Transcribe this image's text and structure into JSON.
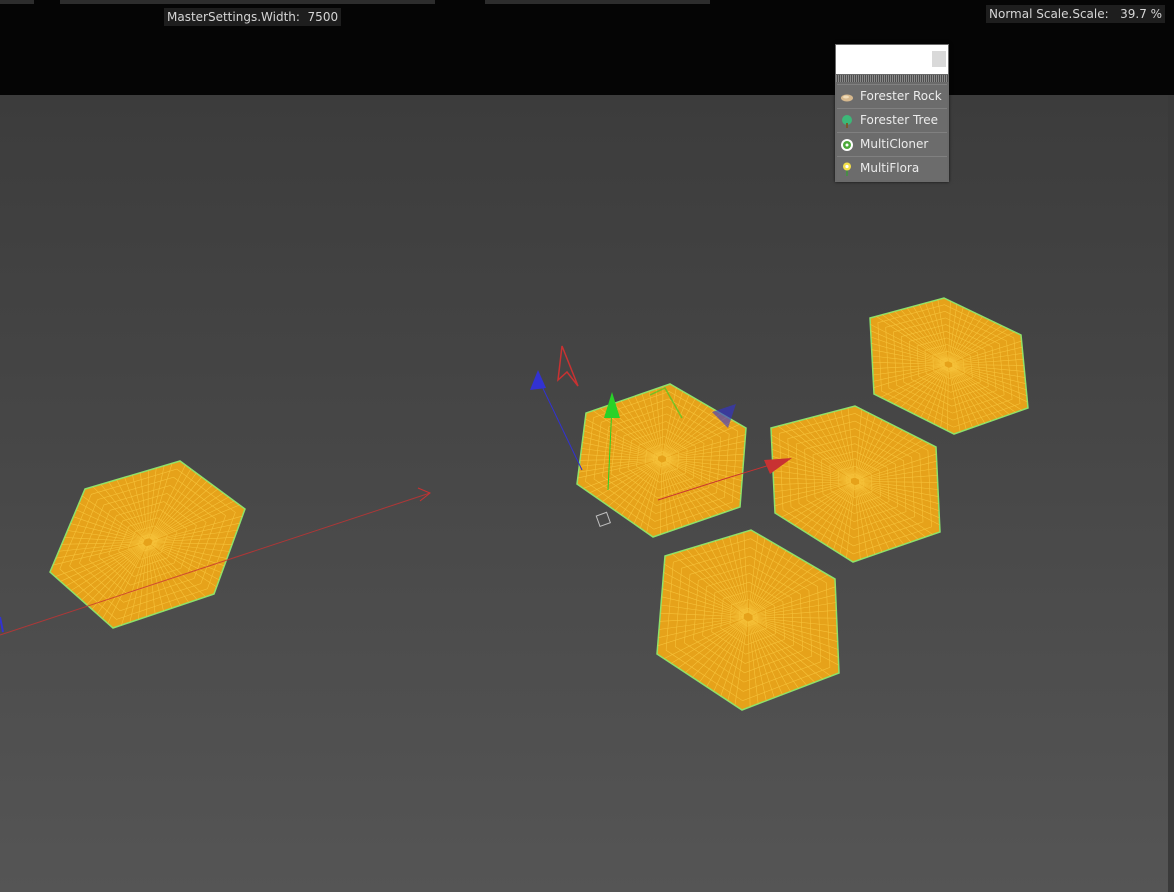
{
  "hud": {
    "width_readout": "MasterSettings.Width:  7500",
    "scale_readout": "Normal Scale.Scale:   39.7 %"
  },
  "plugin_menu": {
    "search_value": "",
    "items": [
      {
        "label": "Forester Rock",
        "icon": "rock-icon"
      },
      {
        "label": "Forester Tree",
        "icon": "tree-icon"
      },
      {
        "label": "MultiCloner",
        "icon": "cloner-icon"
      },
      {
        "label": "MultiFlora",
        "icon": "flower-icon"
      }
    ]
  },
  "colors": {
    "mesh_fill": "#e6a21a",
    "mesh_wire": "#f6c23a",
    "mesh_edge": "#8de26a",
    "axis_x": "#c83232",
    "axis_y": "#28d228",
    "axis_z": "#3232d2"
  }
}
